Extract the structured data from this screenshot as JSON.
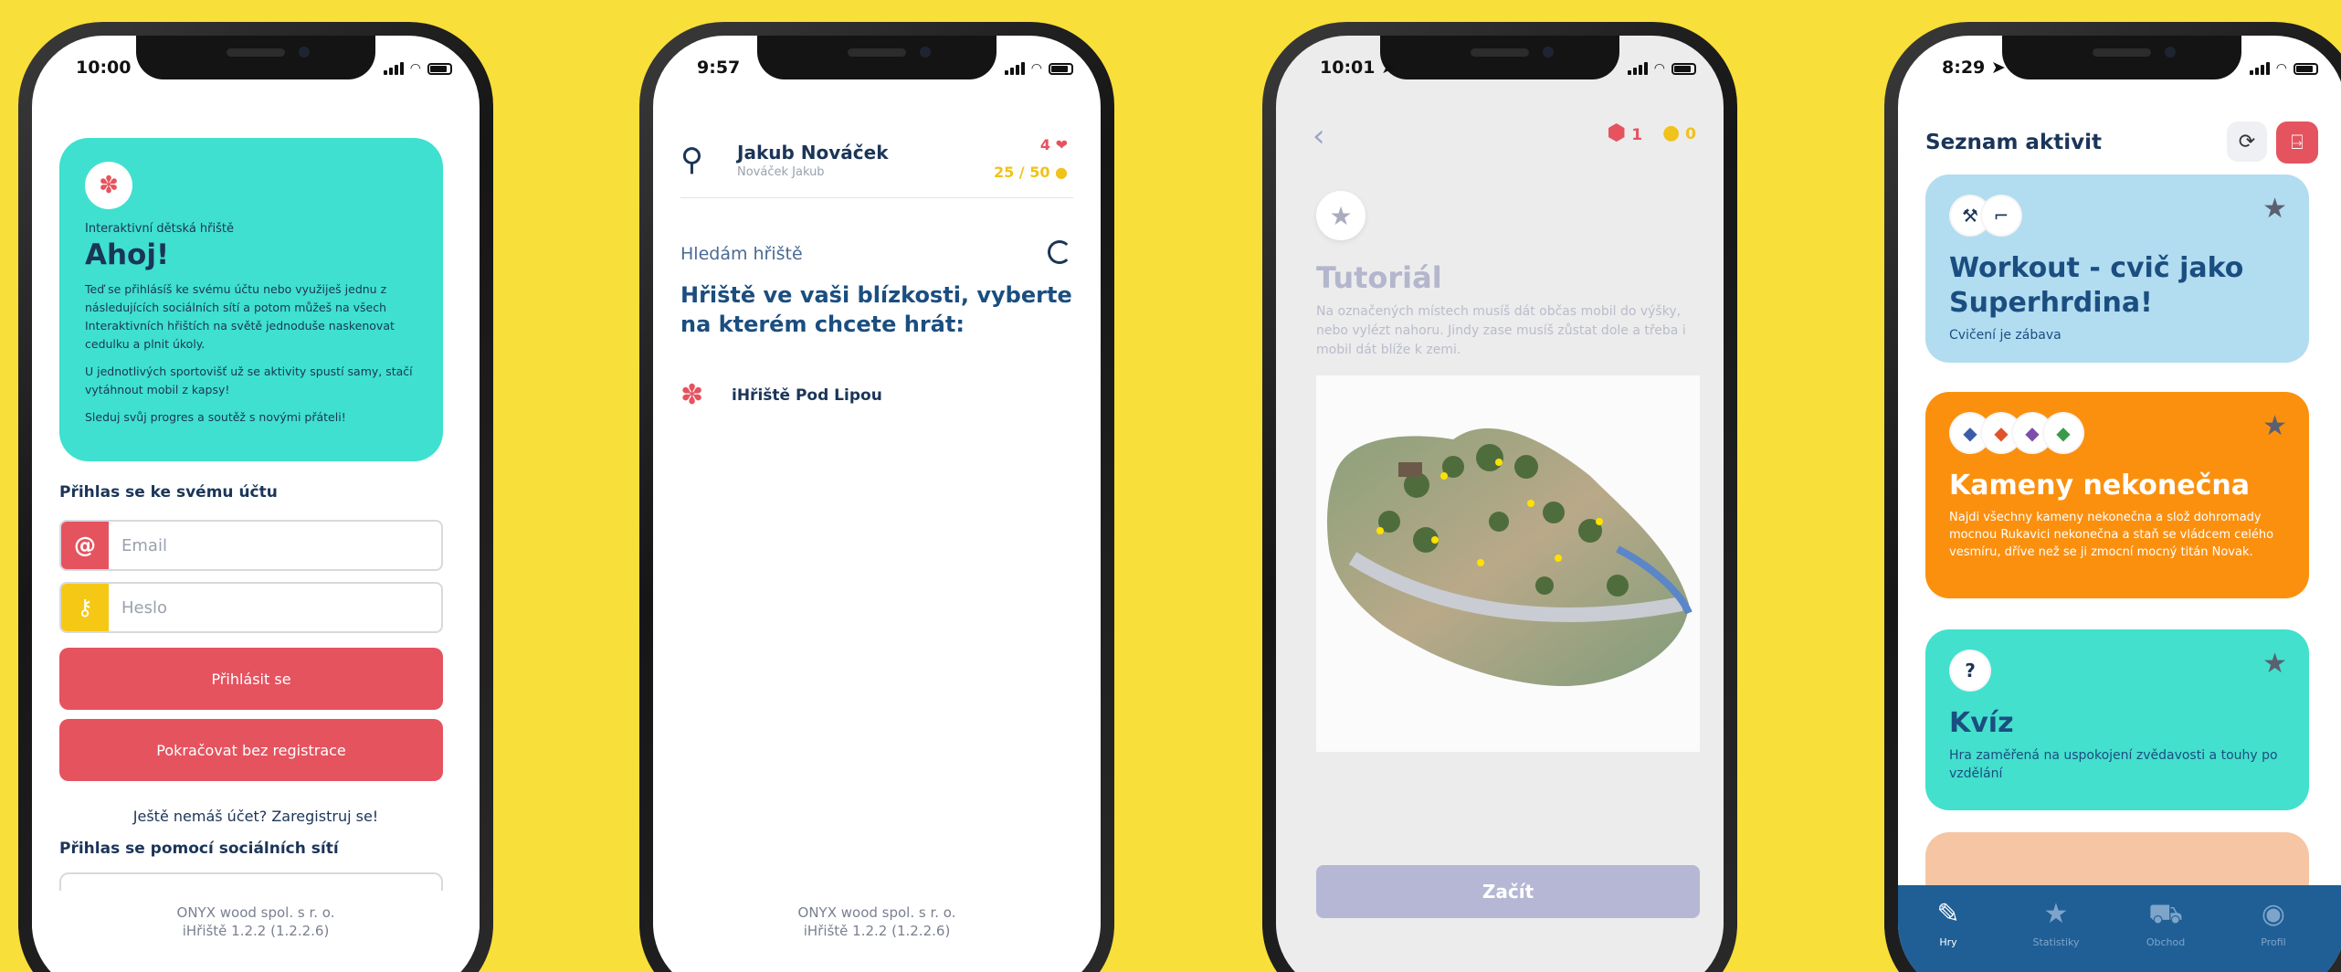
{
  "colors": {
    "background": "#f8df3a",
    "accent_red": "#e5535f",
    "teal": "#3fe0cf",
    "navy": "#1b3558",
    "tabbar": "#1f5f96"
  },
  "phone1": {
    "time": "10:00",
    "kicker": "Interaktivní dětská hřiště",
    "greeting": "Ahoj!",
    "para1": "Teď se přihlásíš ke svému účtu nebo využiješ jednu z následujících sociálních sítí a potom můžeš na všech Interaktivních hřištích na světě jednoduše naskenovat cedulku a plnit úkoly.",
    "para2": "U jednotlivých sportovišť už se aktivity spustí samy, stačí vytáhnout mobil z kapsy!",
    "para3": "Sleduj svůj progres a soutěž s novými přáteli!",
    "login_section": "Přihlas se ke svému účtu",
    "email_placeholder": "Email",
    "password_placeholder": "Heslo",
    "login_button": "Přihlásit se",
    "continue_button": "Pokračovat bez registrace",
    "register_text": "Ještě nemáš účet? Zaregistruj se!",
    "social_section": "Přihlas se pomocí sociálních sítí",
    "footer_company": "ONYX wood spol. s r. o.",
    "footer_version": "iHřiště 1.2.2 (1.2.2.6)"
  },
  "phone2": {
    "time": "9:57",
    "user_name": "Jakub Nováček",
    "user_sub": "Nováček Jakub",
    "hearts": "4",
    "coins": "25 / 50",
    "searching": "Hledám hřiště",
    "headline": "Hřiště ve vaši blízkosti, vyberte na kterém chcete hrát:",
    "playground": "iHřiště Pod Lipou",
    "footer_company": "ONYX wood spol. s r. o.",
    "footer_version": "iHřiště 1.2.2 (1.2.2.6)"
  },
  "phone3": {
    "time": "10:01",
    "gems": "1",
    "coins": "0",
    "title": "Tutoriál",
    "desc": "Na označených místech musíš dát občas mobil do výšky, nebo vylézt nahoru. Jindy zase musíš zůstat dole a třeba i mobil dát blíže k zemi.",
    "start_button": "Začít"
  },
  "phone4": {
    "time": "8:29",
    "title": "Seznam aktivit",
    "cards": [
      {
        "title": "Workout - cvič jako Superhrdina!",
        "sub": "Cvičení je zábava"
      },
      {
        "title": "Kameny nekonečna",
        "sub": "Najdi všechny kameny nekonečna a slož dohromady mocnou Rukavici nekonečna a staň se vládcem celého vesmíru, dříve než se ji zmocní mocný titán Novak."
      },
      {
        "title": "Kvíz",
        "sub": "Hra zaměřená na uspokojení zvědavosti a touhy po vzdělání"
      }
    ],
    "tabs": [
      "Hry",
      "Statistiky",
      "Obchod",
      "Profil"
    ]
  }
}
